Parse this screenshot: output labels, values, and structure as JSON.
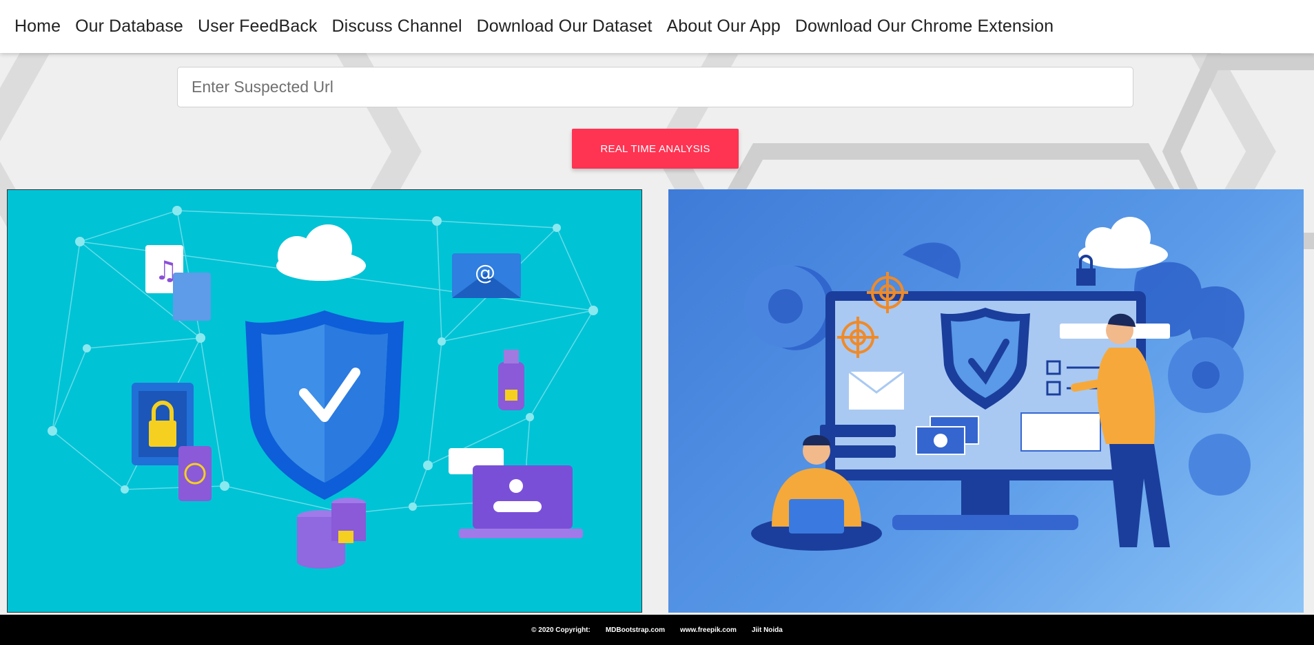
{
  "nav": {
    "items": [
      {
        "label": "Home"
      },
      {
        "label": "Our Database"
      },
      {
        "label": "User FeedBack"
      },
      {
        "label": "Discuss Channel"
      },
      {
        "label": "Download Our Dataset"
      },
      {
        "label": "About Our App"
      },
      {
        "label": "Download Our Chrome Extension"
      }
    ]
  },
  "search": {
    "placeholder": "Enter Suspected Url",
    "value": ""
  },
  "analyze_button": {
    "label": "REAL TIME ANALYSIS"
  },
  "illustrations": {
    "left_alt": "security-shield-network-illustration",
    "right_alt": "cyber-security-monitor-illustration"
  },
  "footer": {
    "copyright": "© 2020 Copyright:",
    "link1": "MDBootstrap.com",
    "link2": "www.freepik.com",
    "link3": "Jiit Noida"
  },
  "colors": {
    "accent": "#ff3352",
    "left_bg": "#00c3d6",
    "right_bg": "#4a8ae0",
    "footer_bg": "#000000"
  }
}
